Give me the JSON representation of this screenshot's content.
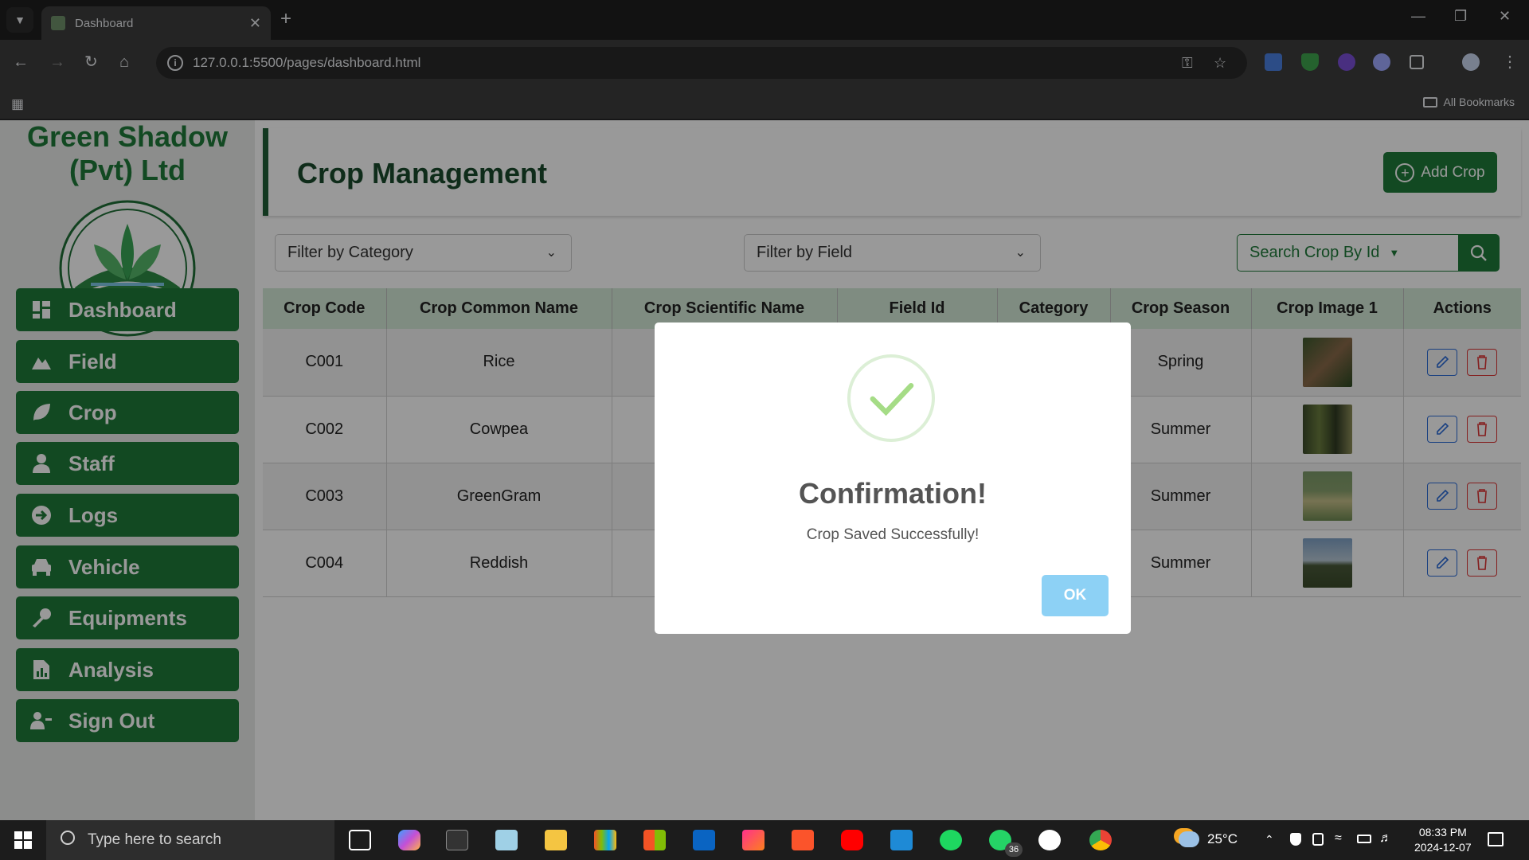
{
  "browser": {
    "tab_title": "Dashboard",
    "url": "127.0.0.1:5500/pages/dashboard.html",
    "bookmarks_label": "All Bookmarks"
  },
  "sidebar": {
    "brand": "Green Shadow (Pvt) Ltd",
    "items": [
      {
        "label": "Dashboard",
        "icon": "dashboard-grid-icon"
      },
      {
        "label": "Field",
        "icon": "mountain-icon"
      },
      {
        "label": "Crop",
        "icon": "leaf-icon"
      },
      {
        "label": "Staff",
        "icon": "person-icon"
      },
      {
        "label": "Logs",
        "icon": "arrow-circle-icon"
      },
      {
        "label": "Vehicle",
        "icon": "car-icon"
      },
      {
        "label": "Equipments",
        "icon": "wrench-icon"
      },
      {
        "label": "Analysis",
        "icon": "report-icon"
      },
      {
        "label": "Sign Out",
        "icon": "user-minus-icon"
      }
    ]
  },
  "header": {
    "title": "Crop Management",
    "add_button": "Add Crop"
  },
  "filters": {
    "category": "Filter by Category",
    "field": "Filter by Field",
    "search": "Search Crop By Id"
  },
  "table": {
    "columns": [
      "Crop Code",
      "Crop Common Name",
      "Crop Scientific Name",
      "Field Id",
      "Category",
      "Crop Season",
      "Crop Image 1",
      "Actions"
    ],
    "rows": [
      {
        "code": "C001",
        "name": "Rice",
        "season": "Spring"
      },
      {
        "code": "C002",
        "name": "Cowpea",
        "season": "Summer"
      },
      {
        "code": "C003",
        "name": "GreenGram",
        "season": "Summer"
      },
      {
        "code": "C004",
        "name": "Reddish",
        "season": "Summer"
      }
    ]
  },
  "dialog": {
    "title": "Confirmation!",
    "message": "Crop Saved Successfully!",
    "ok": "OK"
  },
  "taskbar": {
    "search_placeholder": "Type here to search",
    "temperature": "25°C",
    "time": "08:33 PM",
    "date": "2024-12-07",
    "whatsapp_badge": "36"
  },
  "colors": {
    "brand_green": "#1f7a3a",
    "header_green": "#d4e9d8",
    "ok_button": "#8dd1f5"
  }
}
